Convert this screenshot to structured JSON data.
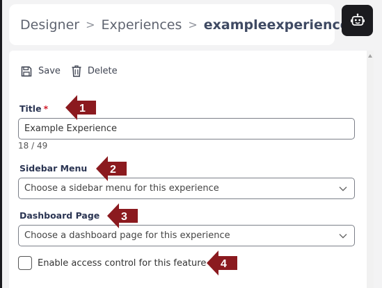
{
  "breadcrumb": {
    "items": [
      "Designer",
      "Experiences"
    ],
    "current": "exampleexperience",
    "separator": ">"
  },
  "bot_button": {
    "icon": "robot-icon"
  },
  "toolbar": {
    "save_label": "Save",
    "save_icon": "floppy-disk-icon",
    "delete_label": "Delete",
    "delete_icon": "trash-icon"
  },
  "form": {
    "title": {
      "label": "Title",
      "required_marker": "*",
      "value": "Example Experience",
      "counter": "18 / 49"
    },
    "sidebar_menu": {
      "label": "Sidebar Menu",
      "placeholder": "Choose a sidebar menu for this experience"
    },
    "dashboard_page": {
      "label": "Dashboard Page",
      "placeholder": "Choose a dashboard page for this experience"
    },
    "access_control": {
      "label": "Enable access control for this feature",
      "checked": false
    }
  },
  "callouts": [
    "1",
    "2",
    "3",
    "4"
  ],
  "colors": {
    "callout": "#8b1a1f",
    "dark": "#1b1b1f",
    "required": "#d11a2a",
    "label": "#2b3553"
  }
}
